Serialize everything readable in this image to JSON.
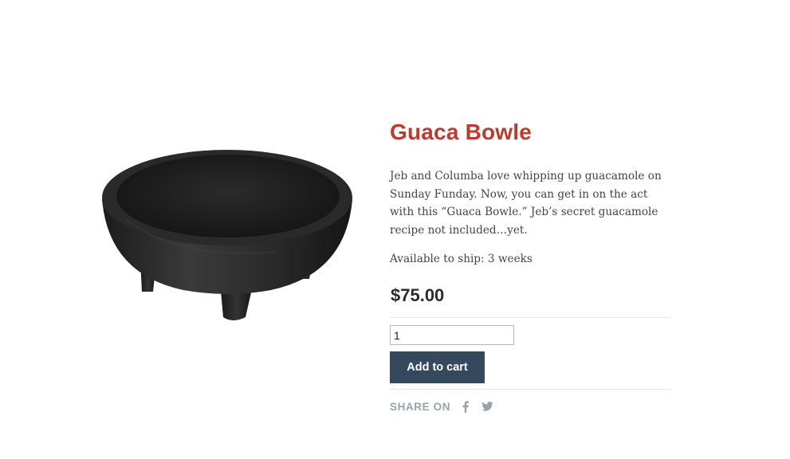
{
  "product": {
    "title": "Guaca Bowle",
    "title_color": "#c0392b",
    "image_alt_icon": "molcajete-bowl-image",
    "description": "Jeb and Columba love whipping up guacamole on Sunday Funday. Now, you can get in on the act with this “Guaca Bowle.” Jeb’s secret guacamole recipe not included…yet.",
    "availability": "Available to ship: 3 weeks",
    "price": "$75.00"
  },
  "cart": {
    "quantity_value": "1",
    "add_label": "Add to cart",
    "button_color": "#34495e"
  },
  "share": {
    "label": "SHARE ON",
    "icons": [
      "facebook-icon",
      "twitter-icon"
    ],
    "icon_color": "#97a2ac"
  }
}
